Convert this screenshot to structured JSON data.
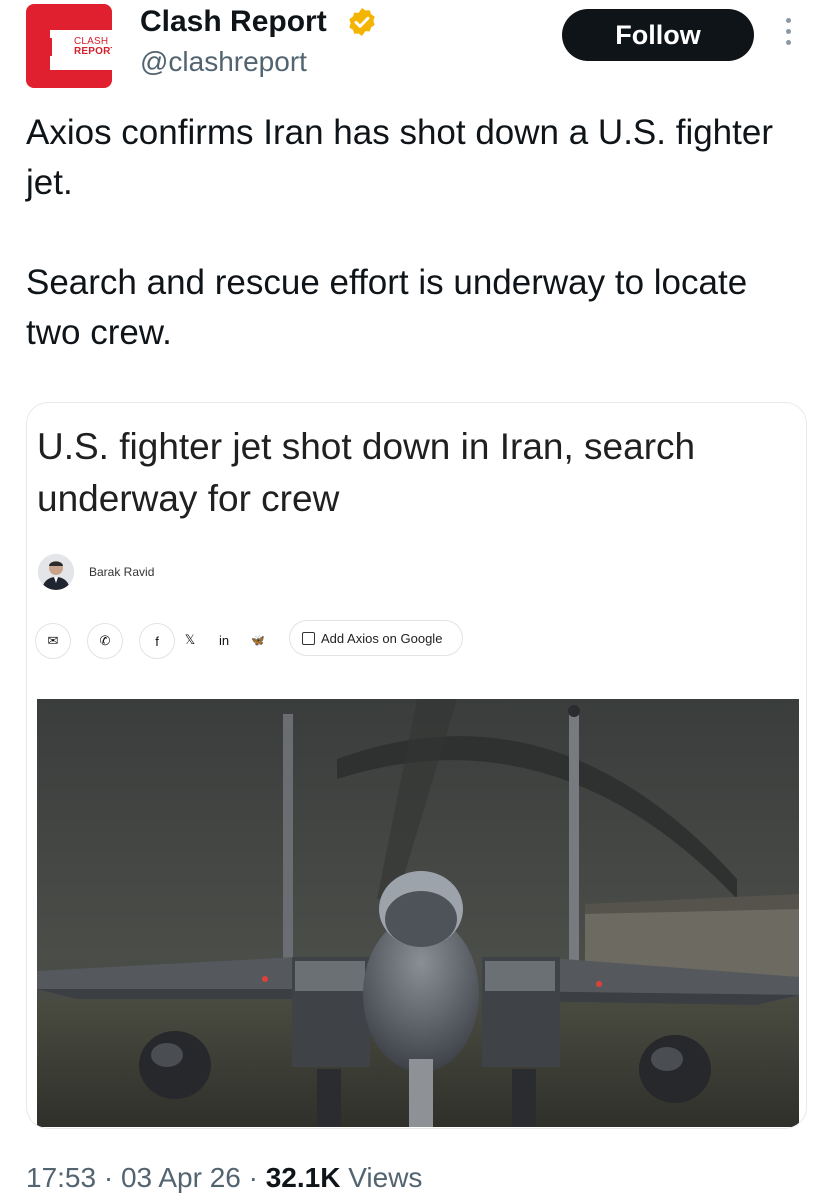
{
  "account": {
    "display_name": "Clash Report",
    "handle": "@clashreport",
    "verified_icon": "verified-badge-icon",
    "verified_color": "#f4b400",
    "logo": {
      "line1": "CLASH",
      "line2": "REPORT",
      "color": "#e0202e"
    }
  },
  "actions": {
    "follow_label": "Follow",
    "more_icon": "more-options-icon"
  },
  "tweet": {
    "paragraph1": "Axios confirms Iran has shot down a U.S. fighter jet.",
    "paragraph2": "Search and rescue effort is underway to locate two crew."
  },
  "card": {
    "headline": "U.S. fighter jet shot down in Iran, search underway for crew",
    "author": "Barak Ravid",
    "share_icons": [
      "email-icon",
      "phone-icon",
      "facebook-icon",
      "x-icon",
      "linkedin-icon",
      "bluesky-icon"
    ],
    "share_glyphs": [
      "✉",
      "✆",
      "f",
      "𝕏",
      "in",
      "🦋"
    ],
    "google_button_label": "Add Axios on Google",
    "image_alt_subject": "fighter jet on runway"
  },
  "footer": {
    "time": "17:53",
    "date": "03 Apr 26",
    "views_count": "32.1K",
    "views_label": "Views",
    "separator": "·"
  }
}
